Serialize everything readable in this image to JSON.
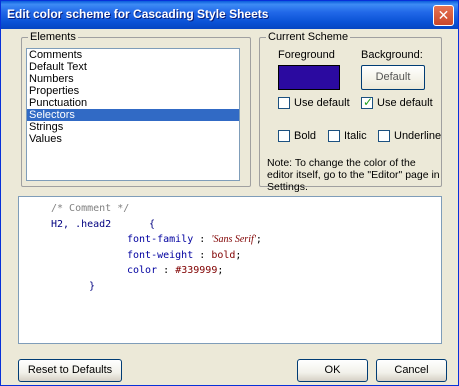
{
  "window": {
    "title": "Edit color scheme for Cascading Style Sheets",
    "close_glyph": "✕"
  },
  "elements": {
    "label": "Elements",
    "items": [
      "Comments",
      "Default Text",
      "Numbers",
      "Properties",
      "Punctuation",
      "Selectors",
      "Strings",
      "Values"
    ],
    "selected": "Selectors"
  },
  "scheme": {
    "label": "Current Scheme",
    "foreground_label": "Foreground",
    "background_label": "Background:",
    "foreground_color": "#2b0aa0",
    "default_button": "Default",
    "use_default_fg": "Use default",
    "use_default_bg": "Use default",
    "use_default_fg_checked": false,
    "use_default_bg_checked": true,
    "bold": "Bold",
    "italic": "Italic",
    "underline": "Underline",
    "note": "Note: To change the color of the editor itself, go to the \"Editor\" page in Settings."
  },
  "preview": {
    "comment": "/* Comment */",
    "selector": "H2, .head2",
    "open_brace": "{",
    "close_brace": "}",
    "prop1": "font-family",
    "value1": "'Sans Serif'",
    "prop2": "font-weight",
    "value2": "bold",
    "prop3": "color",
    "value3": "#339999",
    "colon": ":",
    "semicolon": ";"
  },
  "buttons": {
    "reset": "Reset to Defaults",
    "ok": "OK",
    "cancel": "Cancel"
  }
}
